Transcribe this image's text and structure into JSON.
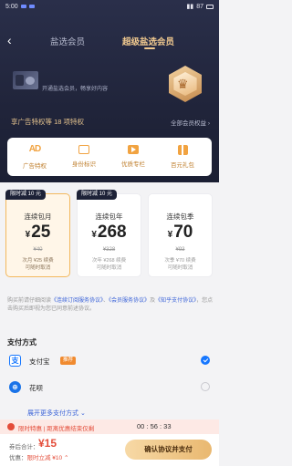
{
  "status_bar": {
    "time": "5:00",
    "battery": "87"
  },
  "nav": {
    "back_icon": "chevron-left-icon",
    "tabs": [
      "盐选会员",
      "超级盐选会员"
    ],
    "active_tab": 1
  },
  "hero": {
    "subtitle": "开通盐选会员，畅享好内容"
  },
  "privileges": {
    "title": "享广告特权等 18 项特权",
    "all_link": "全部会员权益 ›",
    "items": [
      {
        "icon": "ad-icon",
        "glyph": "AD",
        "label": "广告特权"
      },
      {
        "icon": "id-badge-icon",
        "label": "身份标识"
      },
      {
        "icon": "play-icon",
        "label": "优质专栏"
      },
      {
        "icon": "gift-icon",
        "label": "百元礼包"
      }
    ]
  },
  "plans": [
    {
      "tag": "限时减 10 元",
      "name": "连续包月",
      "currency": "¥",
      "price": "25",
      "original": "¥40",
      "note_lines": [
        "次月 ¥25 续费",
        "可随时取消"
      ],
      "selected": true
    },
    {
      "tag": "限时减 10 元",
      "name": "连续包年",
      "currency": "¥",
      "price": "268",
      "original": "¥328",
      "note_lines": [
        "次年 ¥268 续费",
        "可随时取消"
      ],
      "selected": false
    },
    {
      "tag": "",
      "name": "连续包季",
      "currency": "¥",
      "price": "70",
      "original": "¥93",
      "note_lines": [
        "次季 ¥70 续费",
        "可随时取消"
      ],
      "selected": false
    }
  ],
  "agreement": {
    "prefix": "购买前请仔细阅读",
    "link1": "《连续订阅服务协议》",
    "mid1": "、",
    "link2": "《会员服务协议》",
    "mid2": "及",
    "link3": "《知乎支付协议》",
    "suffix": "，您点击购买后即视为您已同意前述协议。"
  },
  "payment": {
    "title": "支付方式",
    "methods": [
      {
        "icon": "alipay-icon",
        "glyph": "支",
        "label": "支付宝",
        "badge": "推荐",
        "selected": true
      },
      {
        "icon": "huabei-icon",
        "glyph": "⊕",
        "label": "花呗",
        "badge": "",
        "selected": false
      }
    ],
    "more": "展开更多支付方式 ⌄"
  },
  "countdown": {
    "text": "限时特惠 | 距离优惠结束仅剩",
    "time": "00 : 56 : 33"
  },
  "footer": {
    "label": "券后合计：",
    "price": "¥15",
    "sub_label": "优惠：",
    "sub_value": "限时立减 ¥10 ⌃",
    "button": "确认协议并支付"
  },
  "colors": {
    "accent": "#f1a341",
    "price_red": "#e44d3a",
    "link_blue": "#3b63d8",
    "hero_bg": "#20243a"
  }
}
